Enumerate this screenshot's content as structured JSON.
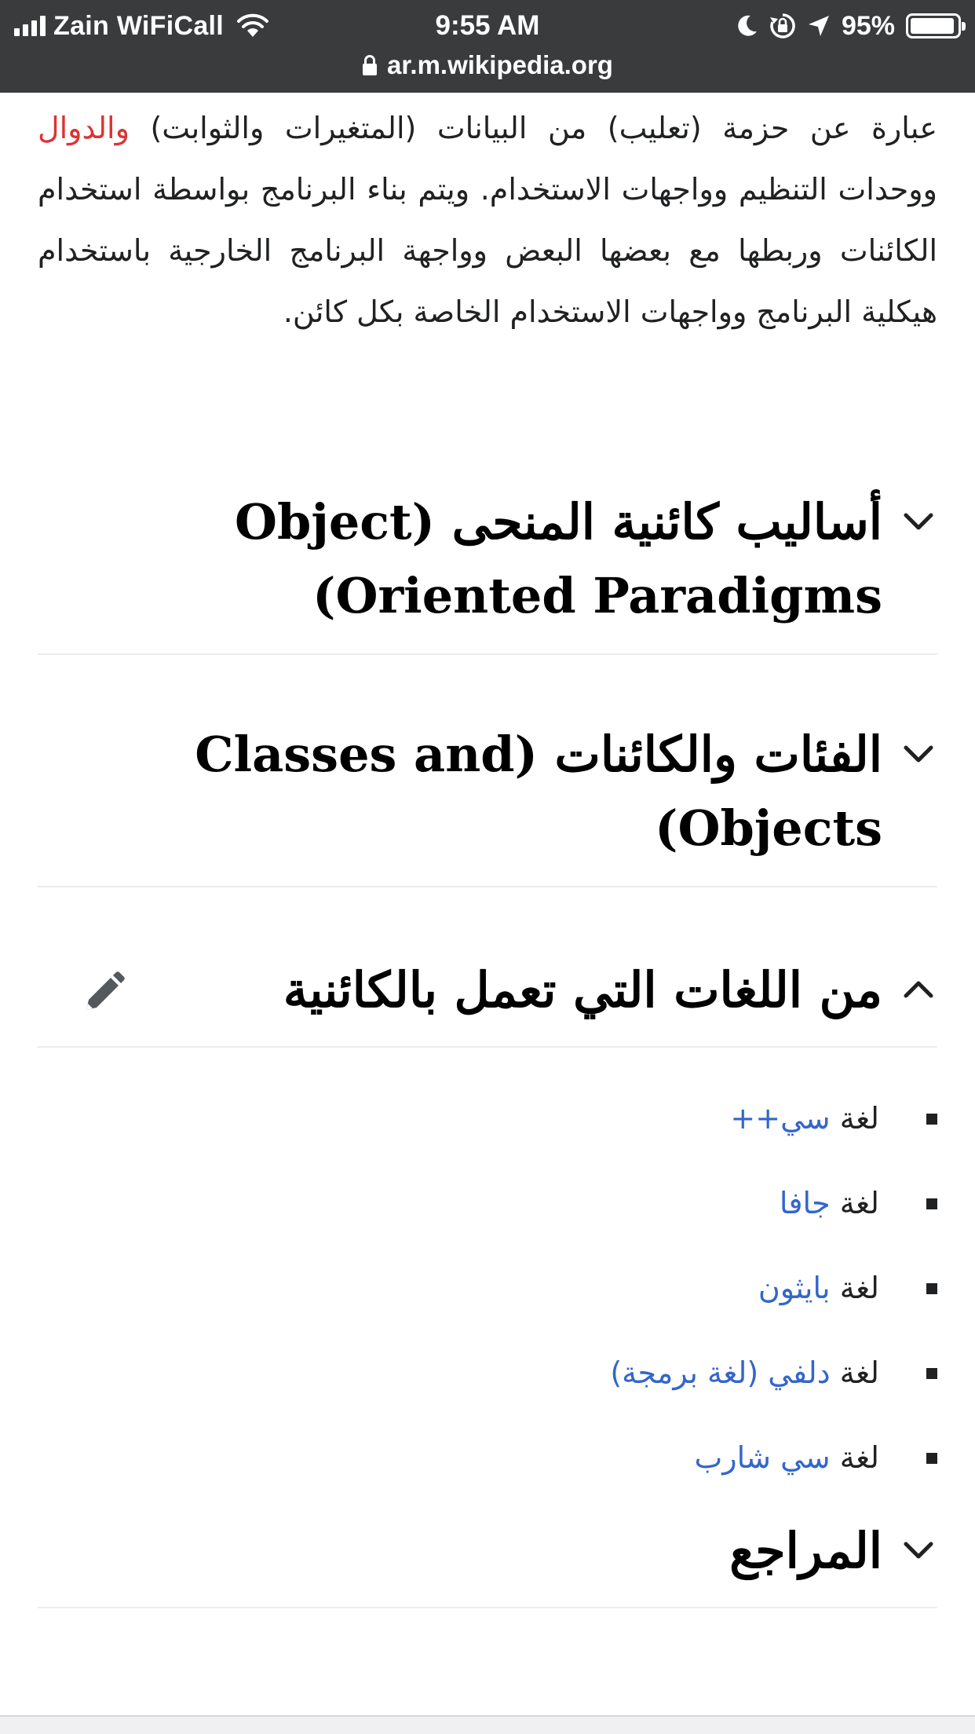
{
  "status_bar": {
    "carrier": "Zain WiFiCall",
    "time": "9:55 AM",
    "battery_percent": "95%",
    "battery_level": 0.95,
    "url": "ar.m.wikipedia.org"
  },
  "article": {
    "intro": {
      "text_1": "عبارة عن حزمة (تعليب) من البيانات (المتغيرات والثوابت) ",
      "link_functions": "والدوال",
      "text_2": " ووحدات التنظيم وواجهات الاستخدام. ويتم بناء البرنامج بواسطة استخدام الكائنات وربطها مع بعضها البعض وواجهة البرنامج الخارجية باستخدام هيكلية البرنامج وواجهات الاستخدام الخاصة بكل كائن."
    },
    "sections": [
      {
        "title": "أساليب كائنية المنحى (Object Oriented Paradigms)",
        "expanded": false
      },
      {
        "title": "الفئات والكائنات (Classes and Objects)",
        "expanded": false
      },
      {
        "title": "من اللغات التي تعمل بالكائنية",
        "expanded": true
      },
      {
        "title": "المراجع",
        "expanded": false
      }
    ],
    "languages": [
      {
        "prefix": "لغة ",
        "link": "سي++"
      },
      {
        "prefix": "لغة ",
        "link": "جافا"
      },
      {
        "prefix": "لغة ",
        "link": "بايثون"
      },
      {
        "prefix": "لغة ",
        "link": "دلفي (لغة برمجة)"
      },
      {
        "prefix": "لغة ",
        "link": "سي شارب"
      }
    ]
  },
  "icons": {
    "chevron_down": "chevron-down-icon",
    "chevron_up": "chevron-up-icon",
    "edit": "pencil-icon"
  },
  "colors": {
    "status_bar": "#3a3b3d",
    "link_blue": "#3366cc",
    "link_red": "#dd3333"
  }
}
